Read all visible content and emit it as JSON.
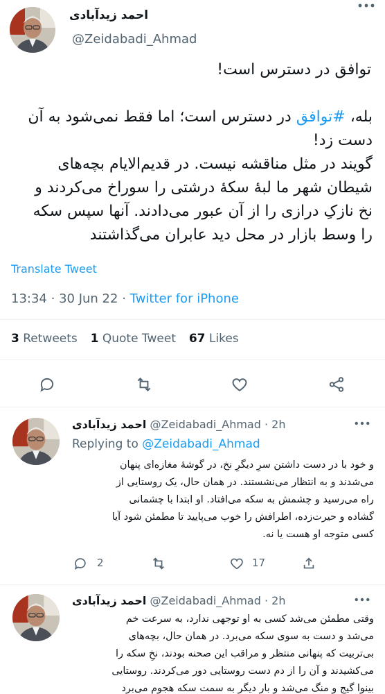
{
  "main_tweet": {
    "author_name": "احمد زیدآبادی",
    "author_handle": "@Zeidabadi_Ahmad",
    "title_line": "توافق در دسترس است!",
    "body_prefix": "بله، ",
    "hashtag": "#توافق",
    "body_line1_rest": " در دسترس است؛ اما فقط نمی‌شود به آن",
    "body_lines": [
      "دست زد!",
      "گویند در مثل مناقشه نیست. در قدیم‌الایام بچه‌های",
      "شیطان شهر ما لبهٔ سکهٔ درشتی را سوراخ می‌کردند و",
      "نخ نازکِ درازی را از آن عبور می‌دادند. آنها سپس سکه",
      "را وسط بازار در محل دید عابران می‌گذاشتند"
    ],
    "translate_label": "Translate Tweet",
    "time": "13:34",
    "date": "30 Jun 22",
    "separator": "·",
    "source": "Twitter for iPhone",
    "retweets_count": "3",
    "retweets_label": "Retweets",
    "quotes_count": "1",
    "quotes_label": "Quote Tweet",
    "likes_count": "67",
    "likes_label": "Likes"
  },
  "reply1": {
    "author_name": "احمد زیدآبادی",
    "author_handle": "@Zeidabadi_Ahmad",
    "separator": "·",
    "time": "2h",
    "replying_label": "Replying to",
    "replying_handle": "@Zeidabadi_Ahmad",
    "lines": [
      "و خود با در دست داشتن سرِ دیگرِ نخ، در گوشهٔ مغازه‌ای پنهان",
      "می‌شدند و به انتظار می‌نشستند. در همان حال، یک روستایی از",
      "راه می‌رسید و چشمش به سکه می‌افتاد. او ابتدا با چشمانی",
      "گشاده و حیرت‌زده، اطرافش را خوب می‌پایید تا مطمئن شود آیا",
      "کسی متوجه او هست یا نه."
    ],
    "reply_count": "2",
    "retweet_count": "",
    "like_count": "17"
  },
  "reply2": {
    "author_name": "احمد زیدآبادی",
    "author_handle": "@Zeidabadi_Ahmad",
    "separator": "·",
    "time": "2h",
    "lines": [
      "وقتی مطمئن می‌شد کسی به او توجهی ندارد، به سرعت خم",
      "می‌شد و دست به سوی سکه می‌برد. در همان حال، بچه‌های",
      "بی‌تربیت که پنهانی منتظر و مراقب این صحنه بودند، نخِ سکه را",
      "می‌کشیدند و آن را از دم دست روستایی دور می‌کردند. روستایی",
      "بینوا گیج و منگ می‌شد و بار دیگر به سمت سکه هجوم می‌برد"
    ]
  }
}
